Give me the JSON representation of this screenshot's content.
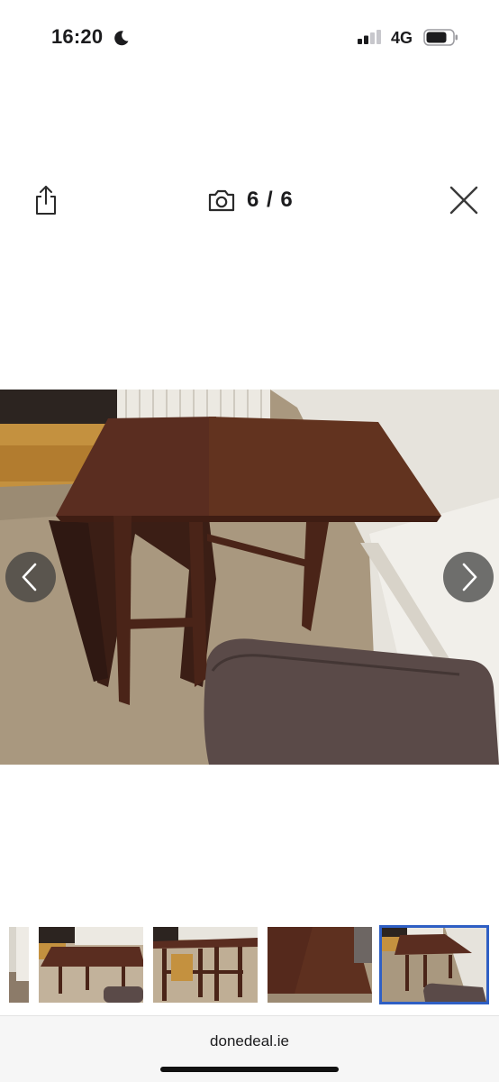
{
  "status_bar": {
    "time": "16:20",
    "network": "4G"
  },
  "viewer": {
    "counter": "6 / 6",
    "icons": {
      "share": "share-icon",
      "camera": "camera-icon",
      "close": "close-icon",
      "prev": "chevron-left-icon",
      "next": "chevron-right-icon"
    },
    "current_photo": 6,
    "total_photos": 6
  },
  "thumbnails": {
    "count_visible": 5,
    "active_index": 4,
    "active_border_color": "#2f5fc4"
  },
  "browser": {
    "url": "donedeal.ie"
  }
}
